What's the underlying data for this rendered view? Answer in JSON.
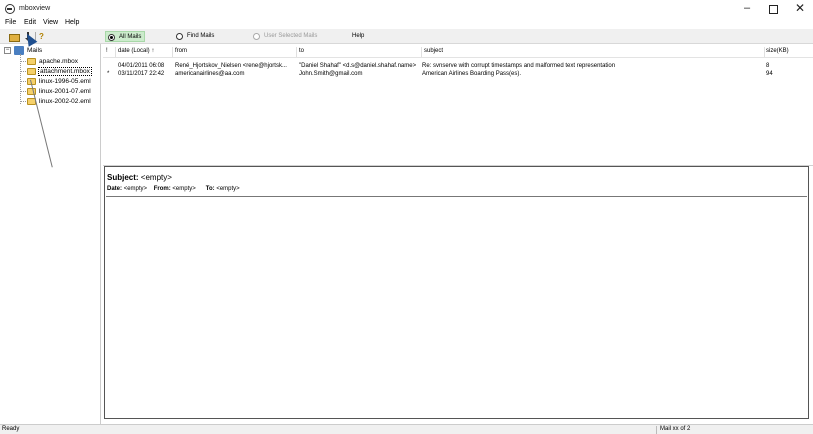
{
  "window": {
    "title": "mboxview"
  },
  "menu": [
    "File",
    "Edit",
    "View",
    "Help"
  ],
  "toolbar": {
    "icons": [
      "open-folder-icon",
      "download-icon",
      "help-icon"
    ],
    "help_glyph": "?"
  },
  "filters": {
    "all_mails": "All Mails",
    "find_mails": "Find Mails",
    "user_selected": "User Selected Mails",
    "help": "Help",
    "selected": "all_mails"
  },
  "tree": {
    "root": "Mails",
    "expander": "−",
    "files": [
      "apache.mbox",
      "attachment.mbox",
      "linux-1996-05.eml",
      "linux-2001-07.eml",
      "linux-2002-02.eml"
    ],
    "selected_index": 1
  },
  "mail_list": {
    "columns": [
      "!",
      "date (Local) ↑",
      "from",
      "to",
      "subject",
      "size(KB)"
    ],
    "rows": [
      {
        "flag": "",
        "date": "04/01/2011 06:08",
        "from": "René_Hjortskov_Nielsen <rene@hjortsk...",
        "to": "\"Daniel Shahaf\" <d.s@daniel.shahaf.name>",
        "subject": "Re: svnserve with corrupt timestamps and malformed text representation",
        "size": "8"
      },
      {
        "flag": "*",
        "date": "03/11/2017 22:42",
        "from": "americanairlines@aa.com",
        "to": "John.Smith@gmail.com",
        "subject": "American Airlines Boarding Pass(es).",
        "size": "94"
      }
    ]
  },
  "preview": {
    "subject_label": "Subject:",
    "subject_value": "<empty>",
    "date_label": "Date:",
    "date_value": "<empty>",
    "from_label": "From:",
    "from_value": "<empty>",
    "to_label": "To:",
    "to_value": "<empty>"
  },
  "status": {
    "left": "Ready",
    "right": "Mail xx of 2"
  }
}
